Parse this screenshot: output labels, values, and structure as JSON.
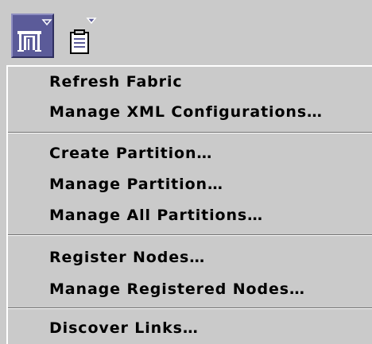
{
  "toolbar": {
    "buttons": [
      {
        "icon": "fabric-icon",
        "active": true,
        "has_dropdown": true
      },
      {
        "icon": "document-icon",
        "active": false,
        "has_dropdown": true
      }
    ]
  },
  "menu": {
    "groups": [
      [
        "Refresh Fabric",
        "Manage XML Configurations…"
      ],
      [
        "Create Partition…",
        "Manage Partition…",
        "Manage All Partitions…"
      ],
      [
        "Register Nodes…",
        "Manage Registered Nodes…"
      ],
      [
        "Discover Links…"
      ]
    ]
  },
  "colors": {
    "background": "#cacaca",
    "active_button": "#5b5b99",
    "text": "#000000"
  }
}
